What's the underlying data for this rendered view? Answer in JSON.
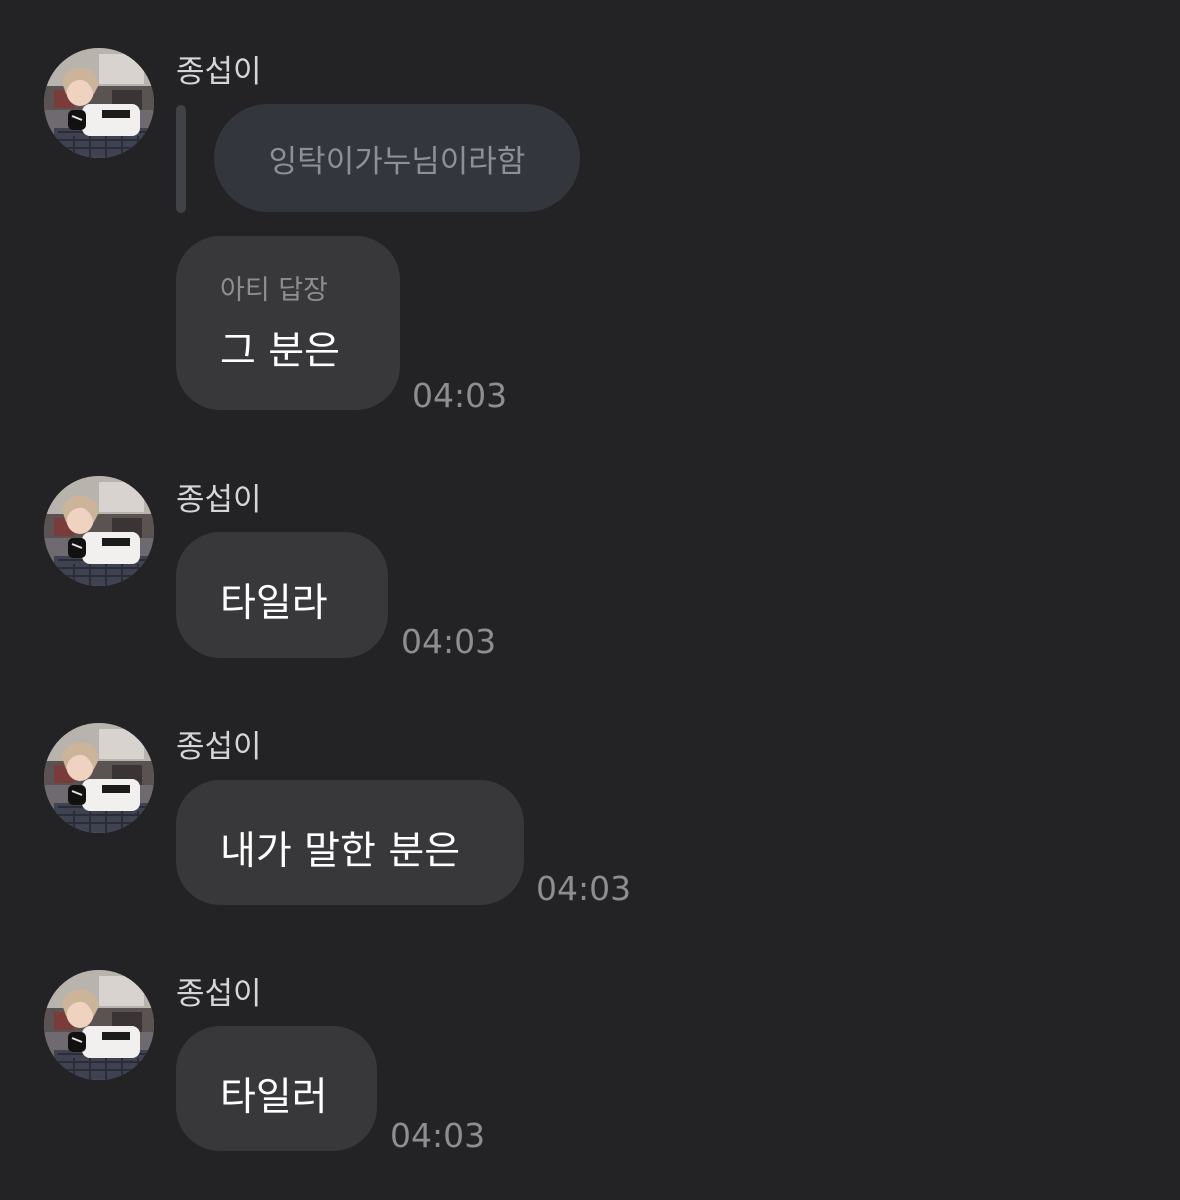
{
  "colors": {
    "background": "#232325",
    "bubble": "#38383b",
    "quote_bubble": "#34363d",
    "quote_bar": "#414248",
    "sender_text": "#d6d6d8",
    "message_text": "#ffffff",
    "muted_text": "#8e8e92"
  },
  "messages": [
    {
      "sender": "종섭이",
      "avatar": "profile-photo-avatar",
      "quoted_text": "잉탁이가누님이라함",
      "reply_label": "아티 답장",
      "text": "그 분은",
      "time": "04:03"
    },
    {
      "sender": "종섭이",
      "avatar": "profile-photo-avatar",
      "text": "타일라",
      "time": "04:03"
    },
    {
      "sender": "종섭이",
      "avatar": "profile-photo-avatar",
      "text": "내가 말한 분은",
      "time": "04:03"
    },
    {
      "sender": "종섭이",
      "avatar": "profile-photo-avatar",
      "text": "타일러",
      "time": "04:03"
    }
  ]
}
